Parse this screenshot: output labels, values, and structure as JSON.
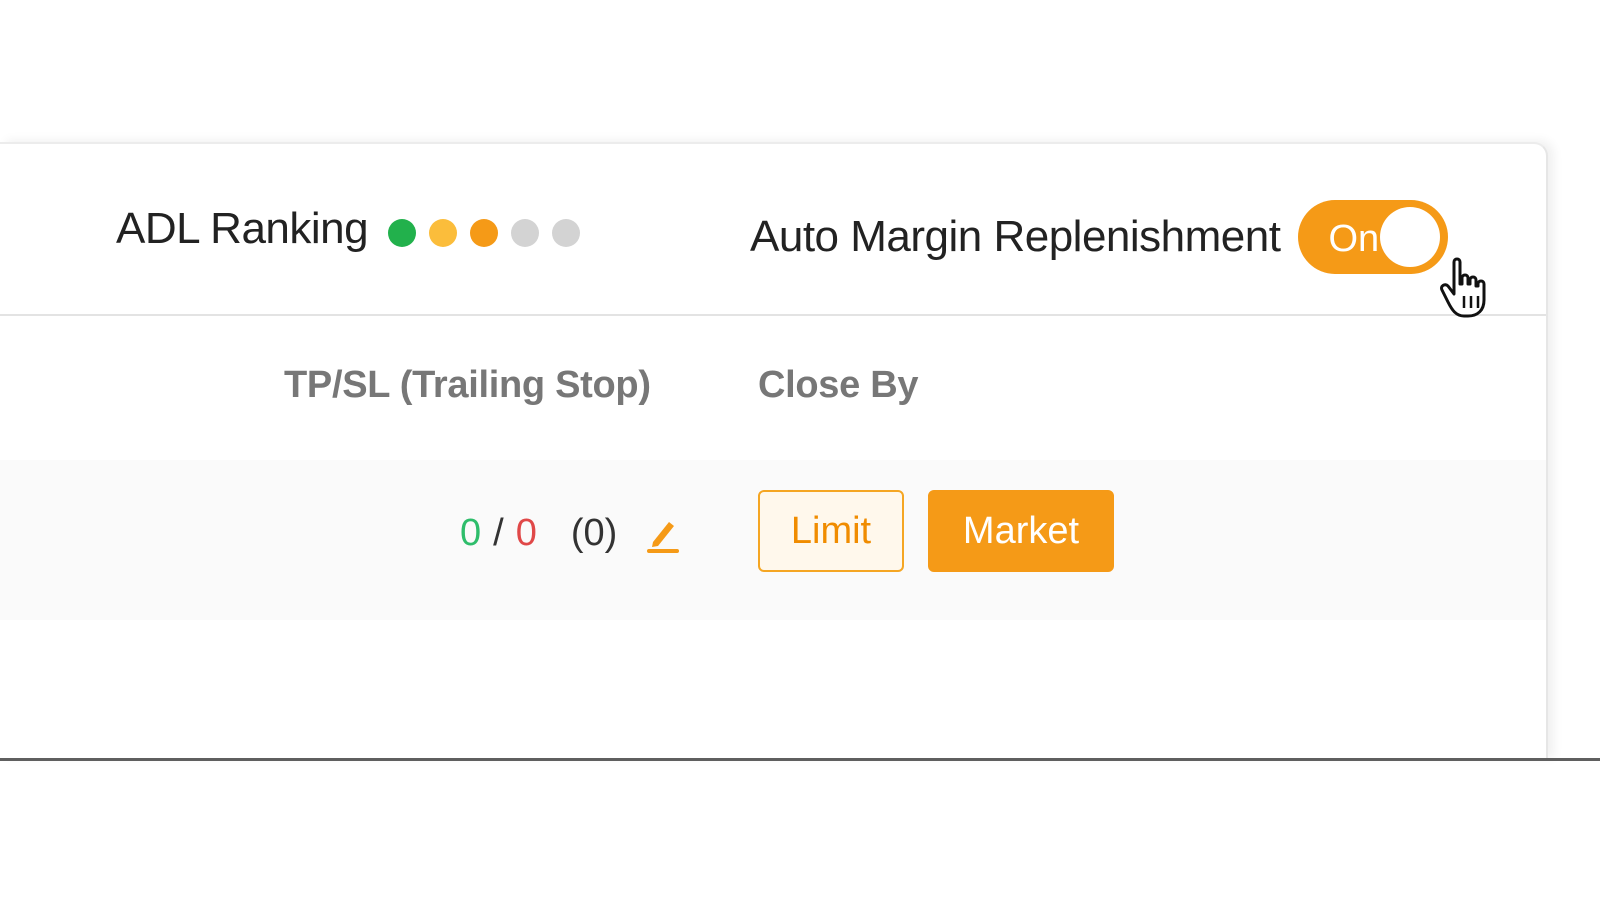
{
  "position_panel": {
    "adl_ranking": {
      "label": "ADL Ranking",
      "indicator_colors": [
        "#22b14c",
        "#fbbd3b",
        "#f59a17",
        "#d3d3d3",
        "#d3d3d3"
      ]
    },
    "auto_margin": {
      "label": "Auto Margin Replenishment",
      "toggle_text": "On",
      "toggle_state": "on",
      "toggle_color": "#f59a17"
    },
    "columns": {
      "tpsl_header": "TP/SL (Trailing Stop)",
      "close_by_header": "Close By"
    },
    "row": {
      "tp_value": "0",
      "separator": "/",
      "sl_value": "0",
      "trailing_value": "(0)",
      "limit_label": "Limit",
      "market_label": "Market"
    },
    "colors": {
      "accent": "#f59a17",
      "profit": "#2ebd6b",
      "loss": "#e04848"
    },
    "icons": {
      "edit": "pencil-icon",
      "cursor": "hand-pointer-icon"
    }
  }
}
